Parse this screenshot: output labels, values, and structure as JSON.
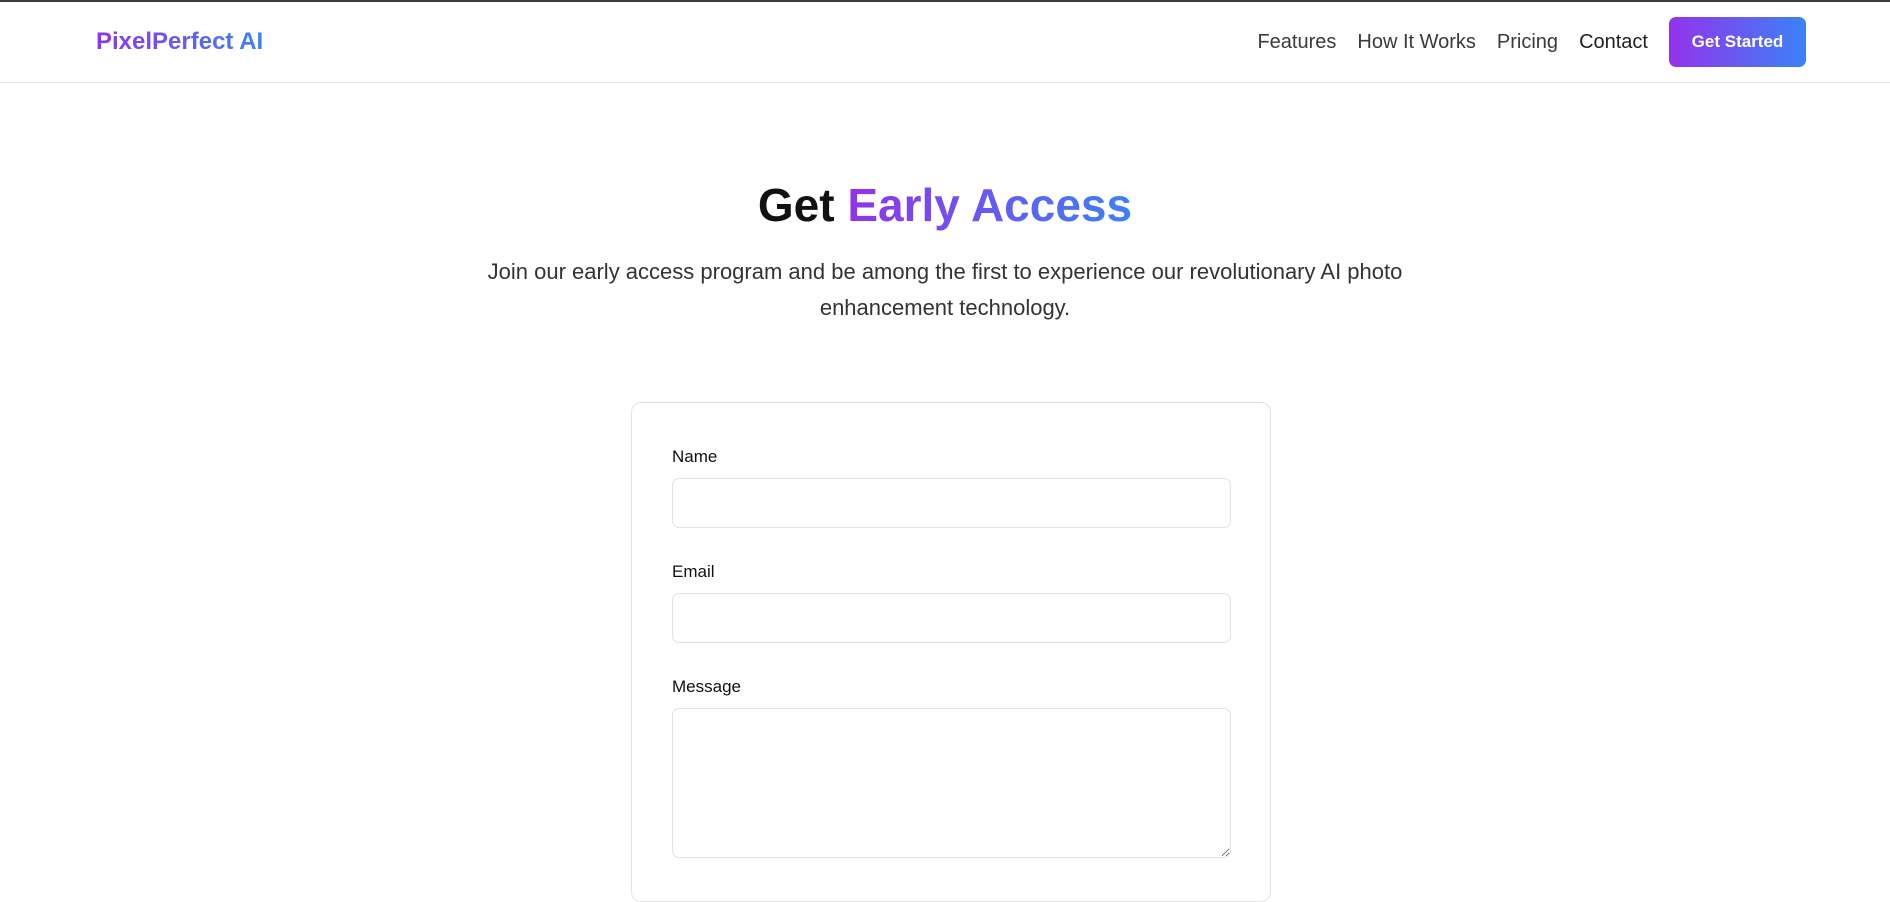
{
  "header": {
    "logo": "PixelPerfect AI",
    "nav": [
      "Features",
      "How It Works",
      "Pricing",
      "Contact"
    ],
    "cta": "Get Started"
  },
  "hero": {
    "title_plain": "Get",
    "title_accent": "Early Access",
    "subtitle": "Join our early access program and be among the first to experience our revolutionary AI photo enhancement technology."
  },
  "form": {
    "name_label": "Name",
    "email_label": "Email",
    "message_label": "Message",
    "name_value": "",
    "email_value": "",
    "message_value": ""
  },
  "colors": {
    "gradient_start": "#9333ea",
    "gradient_end": "#3b82f6"
  }
}
